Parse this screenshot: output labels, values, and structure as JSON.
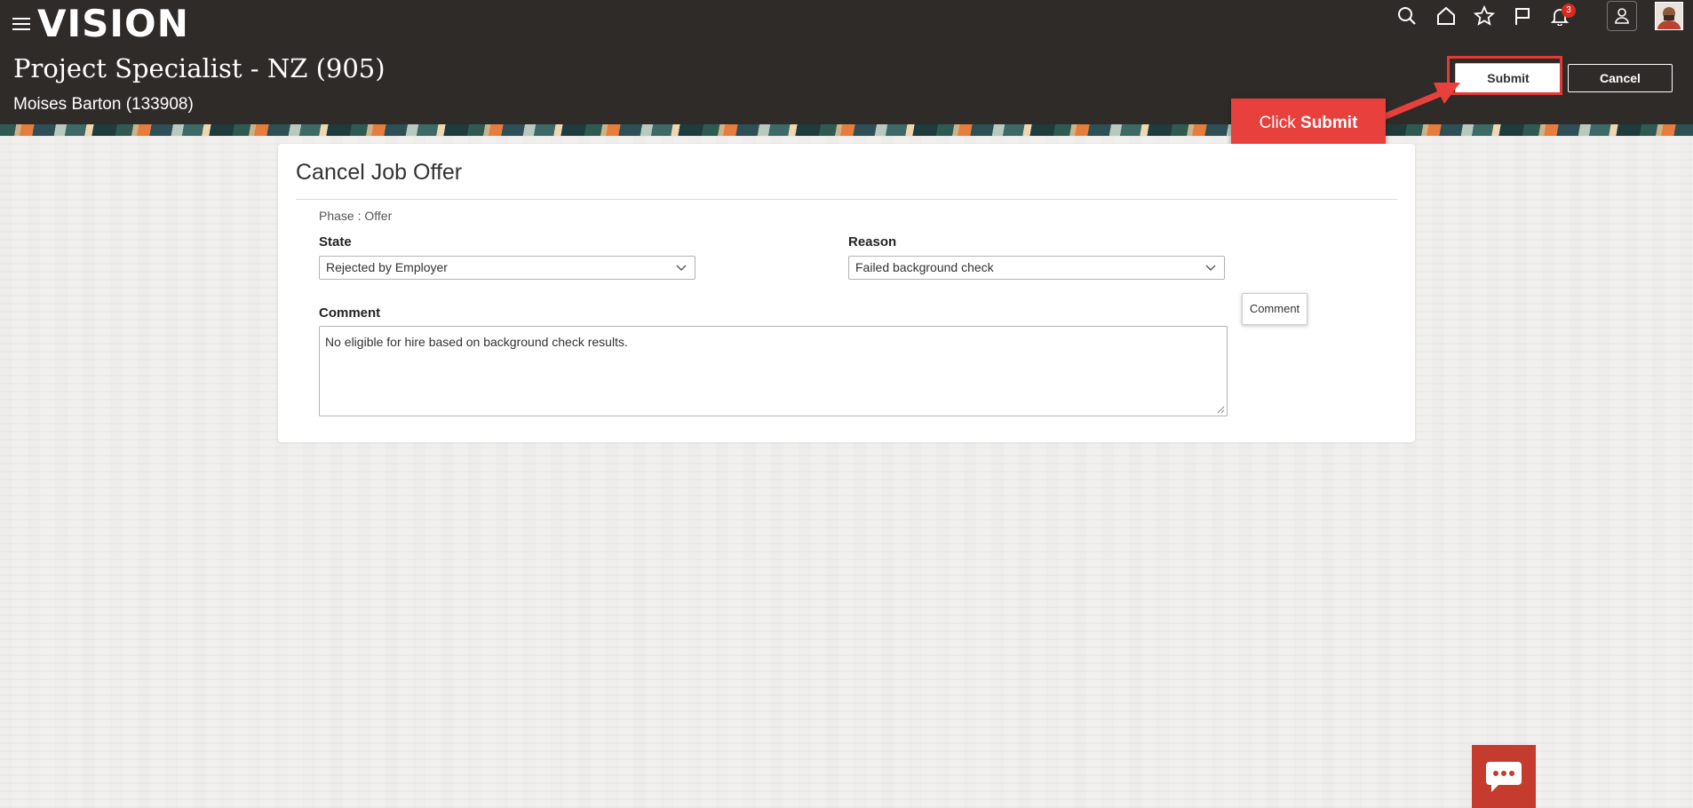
{
  "header": {
    "brand": "VISION",
    "page_title": "Project Specialist - NZ (905)",
    "page_subtitle": "Moises Barton (133908)",
    "notification_count": "3",
    "icons": [
      "menu-icon",
      "search-icon",
      "home-icon",
      "star-icon",
      "flag-icon",
      "bell-icon",
      "user-icon",
      "avatar"
    ]
  },
  "actions": {
    "submit_label": "Submit",
    "cancel_label": "Cancel"
  },
  "callout": {
    "prefix": "Click ",
    "emphasis": "Submit"
  },
  "form": {
    "title": "Cancel Job Offer",
    "phase": "Phase : Offer",
    "state_label": "State",
    "state_value": "Rejected by Employer",
    "reason_label": "Reason",
    "reason_value": "Failed background check",
    "comment_label": "Comment",
    "comment_value": "No eligible for hire based on background check results.",
    "comment_tooltip": "Comment"
  },
  "colors": {
    "header_bg": "#2f2b28",
    "callout_bg": "#e8403d",
    "highlight": "#e53935",
    "chat_bg": "#c53c2e"
  }
}
